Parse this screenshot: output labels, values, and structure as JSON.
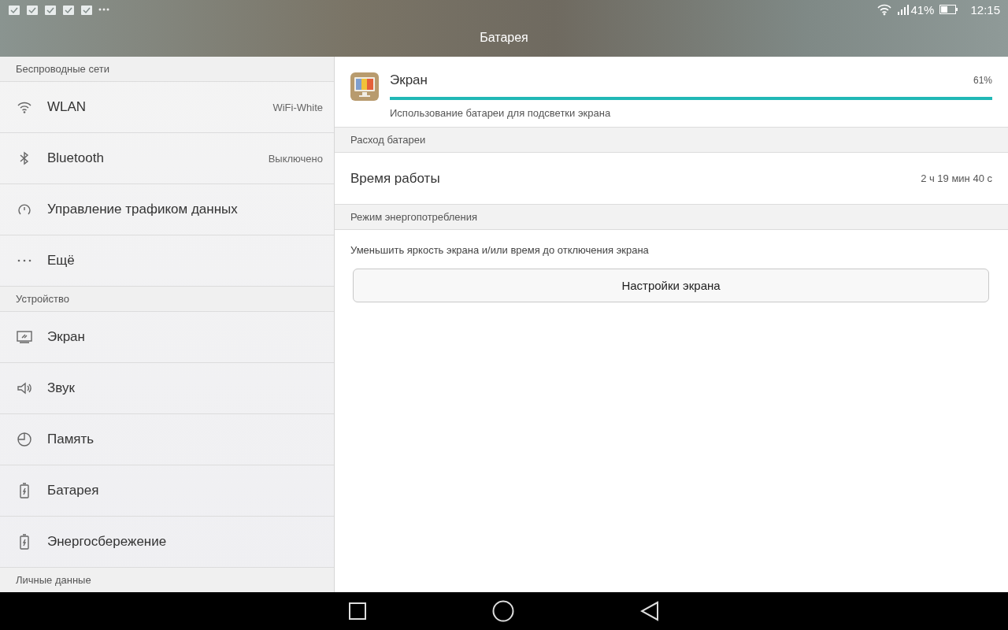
{
  "status_bar": {
    "battery_text": "41%",
    "time": "12:15"
  },
  "title": "Батарея",
  "sidebar": [
    {
      "kind": "header",
      "label": "Беспроводные сети"
    },
    {
      "kind": "item",
      "label": "WLAN",
      "value": "WiFi-White"
    },
    {
      "kind": "item",
      "label": "Bluetooth",
      "value": "Выключено"
    },
    {
      "kind": "item",
      "label": "Управление трафиком данных"
    },
    {
      "kind": "item",
      "label": "Ещё"
    },
    {
      "kind": "header",
      "label": "Устройство"
    },
    {
      "kind": "item",
      "label": "Экран"
    },
    {
      "kind": "item",
      "label": "Звук"
    },
    {
      "kind": "item",
      "label": "Память"
    },
    {
      "kind": "item",
      "label": "Батарея"
    },
    {
      "kind": "item",
      "label": "Энергосбережение"
    },
    {
      "kind": "header",
      "label": "Личные данные"
    }
  ],
  "usage": {
    "name": "Экран",
    "percent": "61%",
    "level": 1,
    "description": "Использование батареи для подсветки экрана"
  },
  "sections": [
    {
      "header": "Расход батареи",
      "rows": [
        {
          "label": "Время работы",
          "value": "2 ч 19 мин 40 с"
        }
      ]
    },
    {
      "header": "Режим энергопотребления",
      "note": "Уменьшить яркость экрана и/или время до отключения экрана",
      "button": "Настройки экрана"
    }
  ]
}
